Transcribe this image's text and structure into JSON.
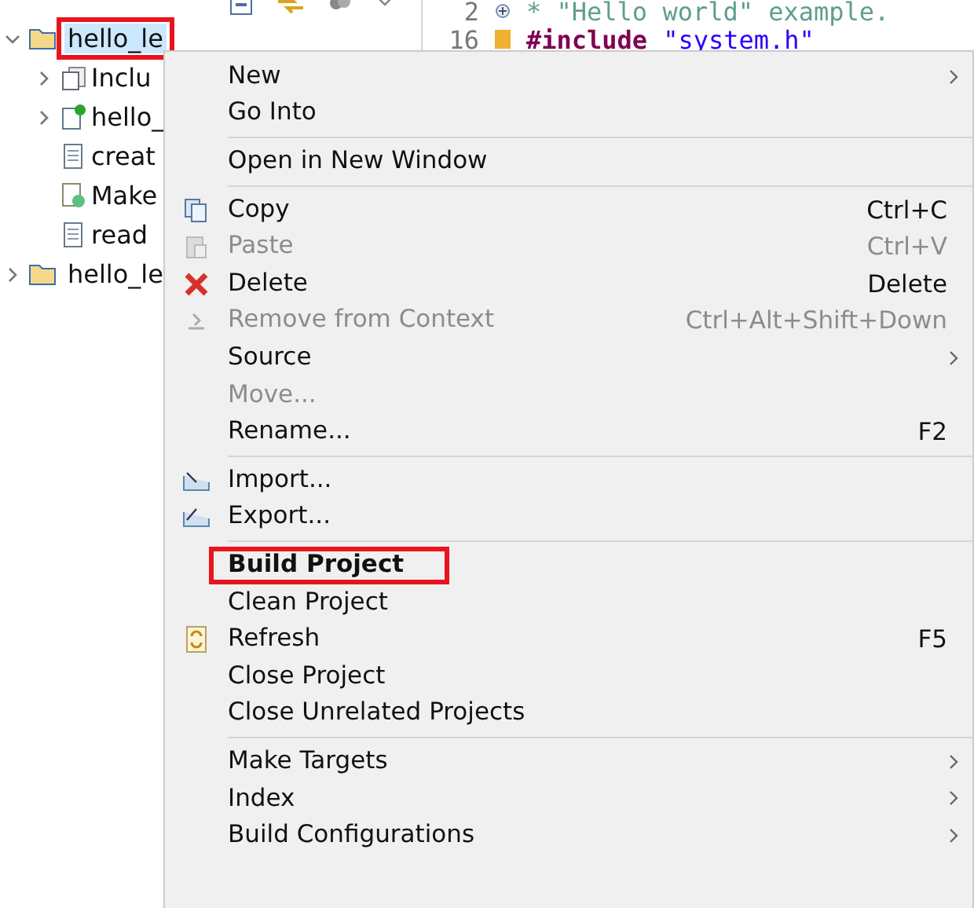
{
  "tree": [
    {
      "label": "hello_le",
      "expanded": true,
      "selected": true,
      "annotated": true,
      "kind": "project",
      "children": [
        {
          "label": "Inclu",
          "kind": "includes",
          "expandable": true
        },
        {
          "label": "hello_",
          "kind": "source",
          "expandable": true
        },
        {
          "label": "creat",
          "kind": "file",
          "expandable": false
        },
        {
          "label": "Make",
          "kind": "makefile",
          "expandable": false
        },
        {
          "label": "read",
          "kind": "file",
          "expandable": false
        }
      ]
    },
    {
      "label": "hello_le",
      "expanded": false,
      "selected": false,
      "annotated": false,
      "kind": "project"
    }
  ],
  "editor": {
    "lines": [
      {
        "number": "2",
        "folded": true,
        "tokens": [
          {
            "kind": "comment",
            "text": "* \"Hello world\" example."
          }
        ]
      },
      {
        "number": "16",
        "folded": false,
        "tokens": [
          {
            "kind": "keyword",
            "text": "#include"
          },
          {
            "kind": "string",
            "text": "\"system.h\""
          }
        ]
      }
    ]
  },
  "menu": [
    {
      "kind": "item",
      "label": "New",
      "submenu": true,
      "disabled": false
    },
    {
      "kind": "item",
      "label": "Go Into",
      "disabled": false
    },
    {
      "kind": "separator"
    },
    {
      "kind": "item",
      "label": "Open in New Window",
      "disabled": false
    },
    {
      "kind": "separator"
    },
    {
      "kind": "item",
      "label": "Copy",
      "shortcut": "Ctrl+C",
      "disabled": false
    },
    {
      "kind": "item",
      "label": "Paste",
      "shortcut": "Ctrl+V",
      "disabled": true
    },
    {
      "kind": "item",
      "label": "Delete",
      "shortcut": "Delete",
      "disabled": false
    },
    {
      "kind": "item",
      "label": "Remove from Context",
      "shortcut": "Ctrl+Alt+Shift+Down",
      "disabled": true
    },
    {
      "kind": "item",
      "label": "Source",
      "submenu": true,
      "disabled": false
    },
    {
      "kind": "item",
      "label": "Move...",
      "disabled": true
    },
    {
      "kind": "item",
      "label": "Rename...",
      "shortcut": "F2",
      "disabled": false
    },
    {
      "kind": "separator"
    },
    {
      "kind": "item",
      "label": "Import...",
      "disabled": false
    },
    {
      "kind": "item",
      "label": "Export...",
      "disabled": false
    },
    {
      "kind": "separator"
    },
    {
      "kind": "item",
      "label": "Build Project",
      "disabled": false,
      "bold": true,
      "annotated": true
    },
    {
      "kind": "item",
      "label": "Clean Project",
      "disabled": false
    },
    {
      "kind": "item",
      "label": "Refresh",
      "shortcut": "F5",
      "disabled": false
    },
    {
      "kind": "item",
      "label": "Close Project",
      "disabled": false
    },
    {
      "kind": "item",
      "label": "Close Unrelated Projects",
      "disabled": false
    },
    {
      "kind": "separator"
    },
    {
      "kind": "item",
      "label": "Make Targets",
      "submenu": true,
      "disabled": false
    },
    {
      "kind": "item",
      "label": "Index",
      "submenu": true,
      "disabled": false
    },
    {
      "kind": "item",
      "label": "Build Configurations",
      "submenu": true,
      "disabled": false
    }
  ]
}
